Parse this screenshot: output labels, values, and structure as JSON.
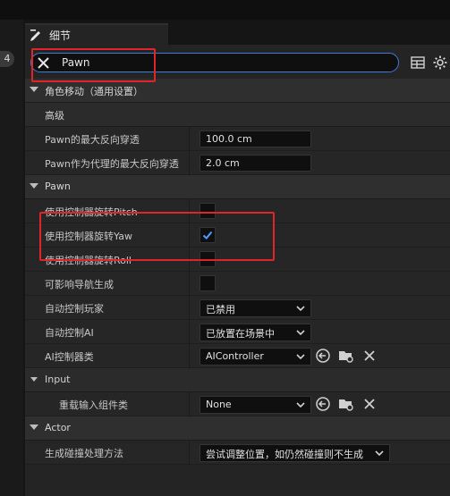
{
  "gutter": {
    "badge": "4"
  },
  "tab": {
    "title": "细节"
  },
  "search": {
    "value": "Pawn"
  },
  "rows": {
    "cat_movement": "角色移动（通用设置）",
    "sub_advanced": "高级",
    "p1_name": "Pawn的最大反向穿透",
    "p1_value": "100.0 cm",
    "p2_name": "Pawn作为代理的最大反向穿透",
    "p2_value": "2.0 cm",
    "cat_pawn": "Pawn",
    "pitch_name": "使用控制器旋转Pitch",
    "yaw_name": "使用控制器旋转Yaw",
    "roll_name": "使用控制器旋转Roll",
    "nav_name": "可影响导航生成",
    "autoplayer_name": "自动控制玩家",
    "autoplayer_value": "已禁用",
    "autoai_name": "自动控制AI",
    "autoai_value": "已放置在场景中",
    "aiclass_name": "AI控制器类",
    "aiclass_value": "AIController",
    "cat_input": "Input",
    "override_name": "重载输入组件类",
    "override_value": "None",
    "cat_actor": "Actor",
    "spawn_name": "生成碰撞处理方法",
    "spawn_value": "尝试调整位置，如仍然碰撞则不生成"
  },
  "state": {
    "pitch_checked": false,
    "yaw_checked": true,
    "roll_checked": false,
    "nav_checked": false
  },
  "colors": {
    "highlight": "#e0242a",
    "focus": "#3e7fd3",
    "check": "#4b9fff"
  }
}
